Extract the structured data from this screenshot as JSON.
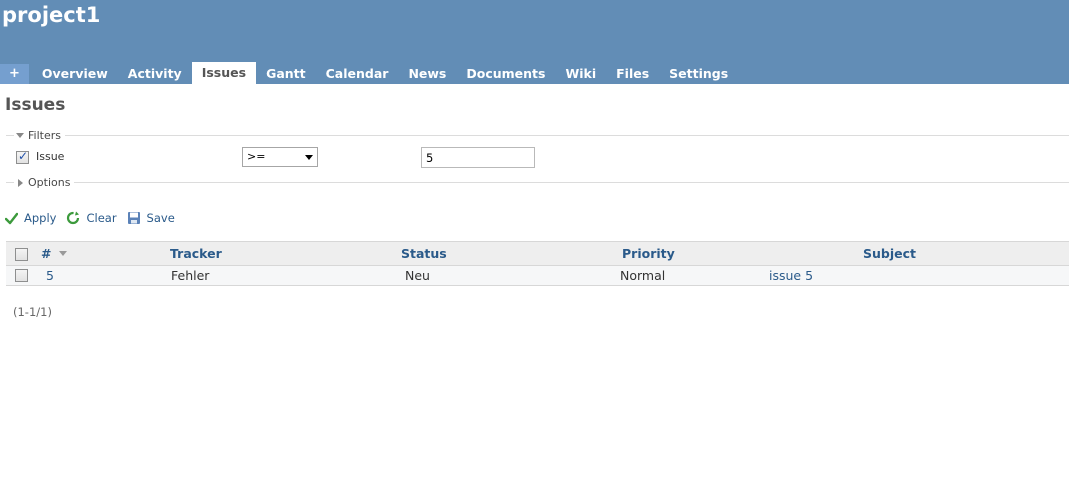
{
  "header": {
    "project_title": "project1"
  },
  "menu": {
    "new_label": "+",
    "tabs": [
      {
        "label": "Overview"
      },
      {
        "label": "Activity"
      },
      {
        "label": "Issues"
      },
      {
        "label": "Gantt"
      },
      {
        "label": "Calendar"
      },
      {
        "label": "News"
      },
      {
        "label": "Documents"
      },
      {
        "label": "Wiki"
      },
      {
        "label": "Files"
      },
      {
        "label": "Settings"
      }
    ],
    "selected": "Issues"
  },
  "page": {
    "heading": "Issues"
  },
  "filters": {
    "legend": "Filters",
    "rows": [
      {
        "label": "Issue",
        "checked": true,
        "operator": ">=",
        "value": "5"
      }
    ]
  },
  "options": {
    "legend": "Options"
  },
  "actions": {
    "apply": "Apply",
    "clear": "Clear",
    "save": "Save"
  },
  "table": {
    "columns": [
      "#",
      "Tracker",
      "Status",
      "Priority",
      "Subject"
    ],
    "rows": [
      {
        "id": "5",
        "tracker": "Fehler",
        "status": "Neu",
        "priority": "Normal",
        "subject": "issue 5"
      }
    ]
  },
  "pagination": {
    "text": "(1-1/1)"
  },
  "colors": {
    "header_bg": "#628db6",
    "link": "#2a5a8a",
    "apply_green": "#3c9a3c"
  }
}
